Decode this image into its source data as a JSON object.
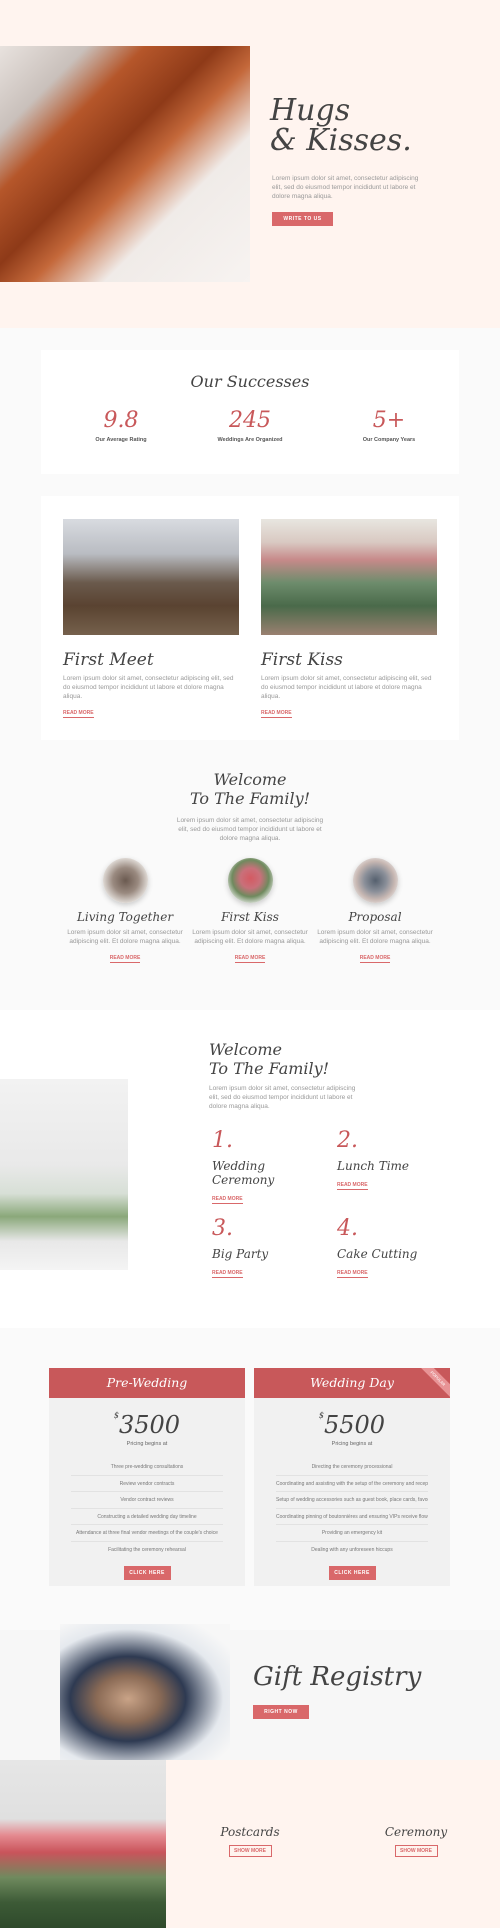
{
  "hero": {
    "title_line1": "Hugs",
    "title_line2": "& Kisses.",
    "text": "Lorem ipsum dolor sit amet, consectetur adipiscing elit, sed do eiusmod tempor incididunt ut labore et dolore magna aliqua.",
    "button": "WRITE TO US"
  },
  "successes": {
    "title": "Our Successes",
    "stats": [
      {
        "value": "9.8",
        "label": "Our Average Rating"
      },
      {
        "value": "245",
        "label": "Weddings Are Organized"
      },
      {
        "value": "5+",
        "label": "Our Company Years"
      }
    ]
  },
  "posts": [
    {
      "title": "First Meet",
      "text": "Lorem ipsum dolor sit amet, consectetur adipiscing elit, sed do eiusmod tempor incididunt ut labore et dolore magna aliqua.",
      "link": "READ MORE"
    },
    {
      "title": "First Kiss",
      "text": "Lorem ipsum dolor sit amet, consectetur adipiscing elit, sed do eiusmod tempor incididunt ut labore et dolore magna aliqua.",
      "link": "READ MORE"
    }
  ],
  "welcome1": {
    "title_line1": "Welcome",
    "title_line2": "To The Family!",
    "text": "Lorem ipsum dolor sit amet, consectetur adipiscing elit, sed do eiusmod tempor incididunt ut labore et dolore magna aliqua.",
    "features": [
      {
        "title": "Living Together",
        "text": "Lorem ipsum dolor sit amet, consectetur adipiscing elit. Et dolore magna aliqua.",
        "link": "READ MORE"
      },
      {
        "title": "First Kiss",
        "text": "Lorem ipsum dolor sit amet, consectetur adipiscing elit. Et dolore magna aliqua.",
        "link": "READ MORE"
      },
      {
        "title": "Proposal",
        "text": "Lorem ipsum dolor sit amet, consectetur adipiscing elit. Et dolore magna aliqua.",
        "link": "READ MORE"
      }
    ]
  },
  "welcome2": {
    "title_line1": "Welcome",
    "title_line2": "To The Family!",
    "text": "Lorem ipsum dolor sit amet, consectetur adipiscing elit, sed do eiusmod tempor incididunt ut labore et dolore magna aliqua.",
    "events": [
      {
        "num": "1.",
        "title": "Wedding Ceremony",
        "link": "READ MORE"
      },
      {
        "num": "2.",
        "title": "Lunch Time",
        "link": "READ MORE"
      },
      {
        "num": "3.",
        "title": "Big Party",
        "link": "READ MORE"
      },
      {
        "num": "4.",
        "title": "Cake Cutting",
        "link": "READ MORE"
      }
    ]
  },
  "pricing": [
    {
      "title": "Pre-Wedding",
      "currency": "$",
      "price": "3500",
      "sub": "Pricing begins at",
      "items": [
        "Three pre-wedding consultations",
        "Review vendor contracts",
        "Vendor contract reviews",
        "Constructing a detailed wedding day timeline",
        "Attendance at three final vendor meetings of the couple's choice",
        "Facilitating the ceremony rehearsal"
      ],
      "button": "CLICK HERE"
    },
    {
      "title": "Wedding Day",
      "currency": "$",
      "price": "5500",
      "sub": "Pricing begins at",
      "ribbon": "POPULAR",
      "items": [
        "Directing the ceremony processional",
        "Coordinating and assisting with the setup of the ceremony and reception",
        "Setup of wedding accessories such as guest book, place cards, favors, etc.",
        "Coordinating pinning of boutonnières and ensuring VIPs receive flowers",
        "Providing an emergency kit",
        "Dealing with any unforeseen hiccups"
      ],
      "button": "CLICK HERE"
    }
  ],
  "gift": {
    "title": "Gift Registry",
    "button": "RIGHT NOW"
  },
  "links": [
    {
      "title": "Postcards",
      "button": "SHOW MORE"
    },
    {
      "title": "Ceremony",
      "button": "SHOW MORE"
    }
  ]
}
